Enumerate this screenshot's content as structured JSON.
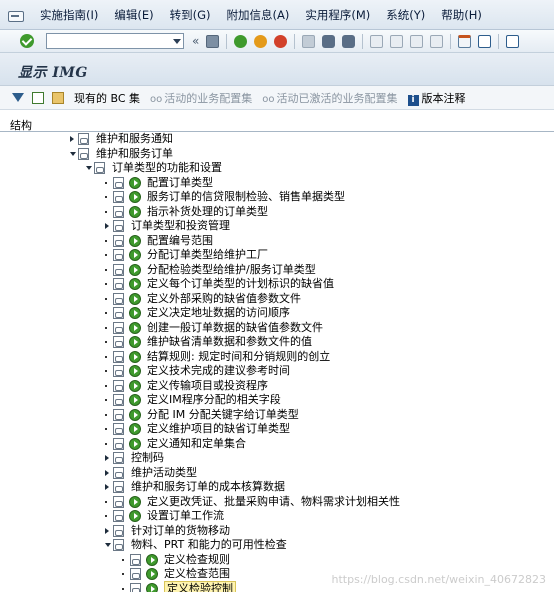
{
  "menu": {
    "items": [
      "实施指南(I)",
      "编辑(E)",
      "转到(G)",
      "附加信息(A)",
      "实用程序(M)",
      "系统(Y)",
      "帮助(H)"
    ]
  },
  "toolbar": {
    "command_value": "",
    "double_arrow": "«"
  },
  "title": "显示 IMG",
  "app_toolbar": {
    "bc_set": "现有的 BC 集",
    "active_bc_set": "活动的业务配置集",
    "activated_bc_set": "活动已激活的业务配置集",
    "release_notes": "版本注释"
  },
  "tree_header": "结构",
  "tree": [
    {
      "level": 0,
      "type": "closed",
      "glyphs": [
        "doc"
      ],
      "label": "维护和服务通知"
    },
    {
      "level": 0,
      "type": "open",
      "glyphs": [
        "doc"
      ],
      "label": "维护和服务订单"
    },
    {
      "level": 1,
      "type": "open",
      "glyphs": [
        "doc"
      ],
      "label": "订单类型的功能和设置"
    },
    {
      "level": 2,
      "type": "bullet",
      "glyphs": [
        "doc",
        "exec"
      ],
      "label": "配置订单类型"
    },
    {
      "level": 2,
      "type": "bullet",
      "glyphs": [
        "doc",
        "exec"
      ],
      "label": "服务订单的信贷限制检验、销售单据类型"
    },
    {
      "level": 2,
      "type": "bullet",
      "glyphs": [
        "doc",
        "exec"
      ],
      "label": "指示补货处理的订单类型"
    },
    {
      "level": 2,
      "type": "closed",
      "glyphs": [
        "doc"
      ],
      "label": "订单类型和投资管理"
    },
    {
      "level": 2,
      "type": "bullet",
      "glyphs": [
        "doc",
        "exec"
      ],
      "label": "配置编号范围"
    },
    {
      "level": 2,
      "type": "bullet",
      "glyphs": [
        "doc",
        "exec"
      ],
      "label": "分配订单类型给维护工厂"
    },
    {
      "level": 2,
      "type": "bullet",
      "glyphs": [
        "doc",
        "exec"
      ],
      "label": "分配检验类型给维护/服务订单类型"
    },
    {
      "level": 2,
      "type": "bullet",
      "glyphs": [
        "doc",
        "exec"
      ],
      "label": "定义每个订单类型的计划标识的缺省值"
    },
    {
      "level": 2,
      "type": "bullet",
      "glyphs": [
        "doc",
        "exec"
      ],
      "label": "定义外部采购的缺省值参数文件"
    },
    {
      "level": 2,
      "type": "bullet",
      "glyphs": [
        "doc",
        "exec"
      ],
      "label": "定义决定地址数据的访问顺序"
    },
    {
      "level": 2,
      "type": "bullet",
      "glyphs": [
        "doc",
        "exec"
      ],
      "label": "创建一般订单数据的缺省值参数文件"
    },
    {
      "level": 2,
      "type": "bullet",
      "glyphs": [
        "doc",
        "exec"
      ],
      "label": "维护缺省清单数据和参数文件的值"
    },
    {
      "level": 2,
      "type": "bullet",
      "glyphs": [
        "doc",
        "exec"
      ],
      "label": "结算规则: 规定时间和分销规则的创立"
    },
    {
      "level": 2,
      "type": "bullet",
      "glyphs": [
        "doc",
        "exec"
      ],
      "label": "定义技术完成的建议参考时间"
    },
    {
      "level": 2,
      "type": "bullet",
      "glyphs": [
        "doc",
        "exec"
      ],
      "label": "定义传输项目或投资程序"
    },
    {
      "level": 2,
      "type": "bullet",
      "glyphs": [
        "doc",
        "exec"
      ],
      "label": "定义IM程序分配的相关字段"
    },
    {
      "level": 2,
      "type": "bullet",
      "glyphs": [
        "doc",
        "exec"
      ],
      "label": "分配 IM 分配关键字给订单类型"
    },
    {
      "level": 2,
      "type": "bullet",
      "glyphs": [
        "doc",
        "exec"
      ],
      "label": "定义维护项目的缺省订单类型"
    },
    {
      "level": 2,
      "type": "bullet",
      "glyphs": [
        "doc",
        "exec"
      ],
      "label": "定义通知和定单集合"
    },
    {
      "level": 2,
      "type": "closed",
      "glyphs": [
        "doc"
      ],
      "label": "控制码"
    },
    {
      "level": 2,
      "type": "closed",
      "glyphs": [
        "doc"
      ],
      "label": "维护活动类型"
    },
    {
      "level": 2,
      "type": "closed",
      "glyphs": [
        "doc"
      ],
      "label": "维护和服务订单的成本核算数据"
    },
    {
      "level": 2,
      "type": "bullet",
      "glyphs": [
        "doc",
        "exec"
      ],
      "label": "定义更改凭证、批量采购申请、物料需求计划相关性"
    },
    {
      "level": 2,
      "type": "bullet",
      "glyphs": [
        "doc",
        "exec"
      ],
      "label": "设置订单工作流"
    },
    {
      "level": 2,
      "type": "closed",
      "glyphs": [
        "doc"
      ],
      "label": "针对订单的货物移动"
    },
    {
      "level": 2,
      "type": "open",
      "glyphs": [
        "doc"
      ],
      "label": "物料、PRT 和能力的可用性检查"
    },
    {
      "level": 3,
      "type": "bullet",
      "glyphs": [
        "doc",
        "exec"
      ],
      "label": "定义检查规则"
    },
    {
      "level": 3,
      "type": "bullet",
      "glyphs": [
        "doc",
        "exec"
      ],
      "label": "定义检查范围"
    },
    {
      "level": 3,
      "type": "bullet",
      "glyphs": [
        "doc",
        "exec"
      ],
      "label": "定义检验控制",
      "highlight": true
    }
  ],
  "watermark": "https://blog.csdn.net/weixin_40672823"
}
